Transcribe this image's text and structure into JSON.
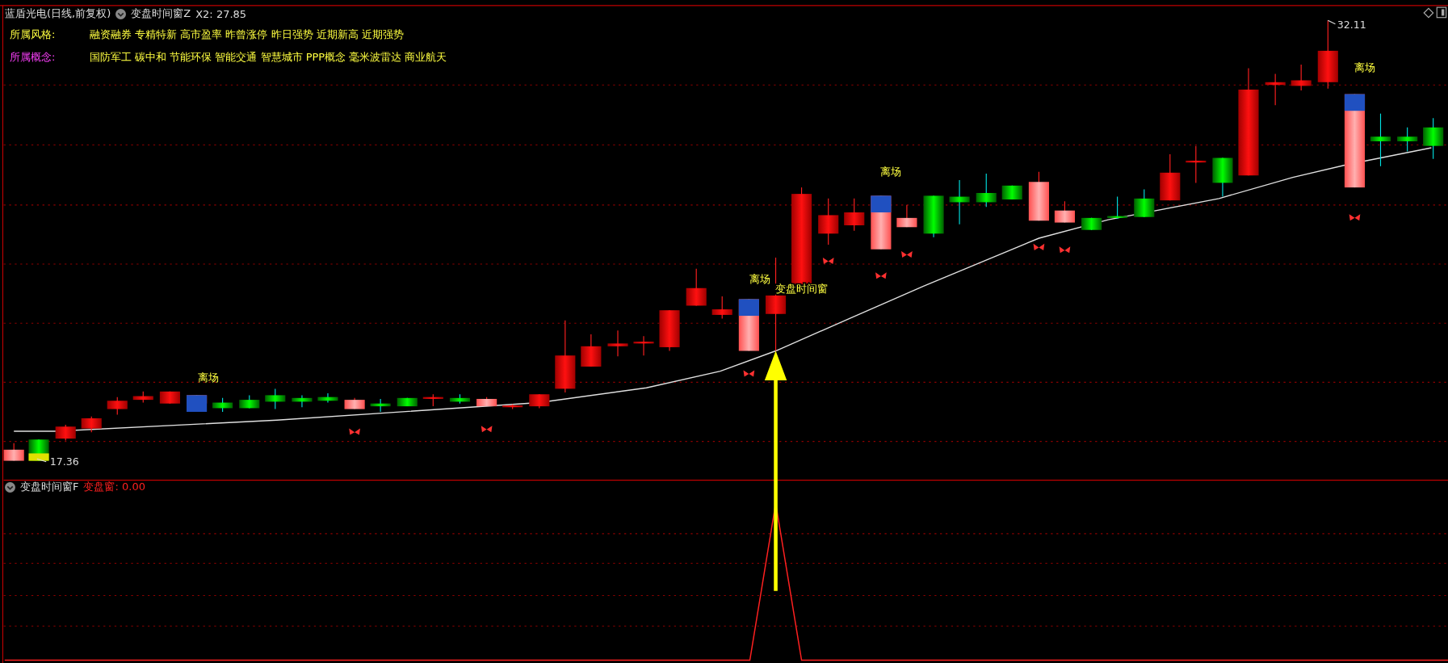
{
  "header": {
    "stock_title": "蓝盾光电(日线,前复权)",
    "indicator": "变盘时间窗Z",
    "indicator_value": "X2: 27.85"
  },
  "tags": [
    {
      "label": "所属风格:",
      "kind": "style",
      "value": "融资融券 专精特新 高市盈率 昨曾涨停 昨日强势 近期新高 近期强势"
    },
    {
      "label": "所属概念:",
      "kind": "concept",
      "value": "国防军工 碳中和 节能环保 智能交通 智慧城市 PPP概念 毫米波雷达 商业航天"
    }
  ],
  "price_chart": {
    "high_label": "32.11",
    "low_label": "17.36",
    "exit_labels": [
      "离场",
      "离场",
      "离场",
      "离场"
    ],
    "signal_label": "变盘时间窗"
  },
  "lower_panel": {
    "name": "变盘时间窗F",
    "reading": "变盘窗: 0.00"
  }
}
